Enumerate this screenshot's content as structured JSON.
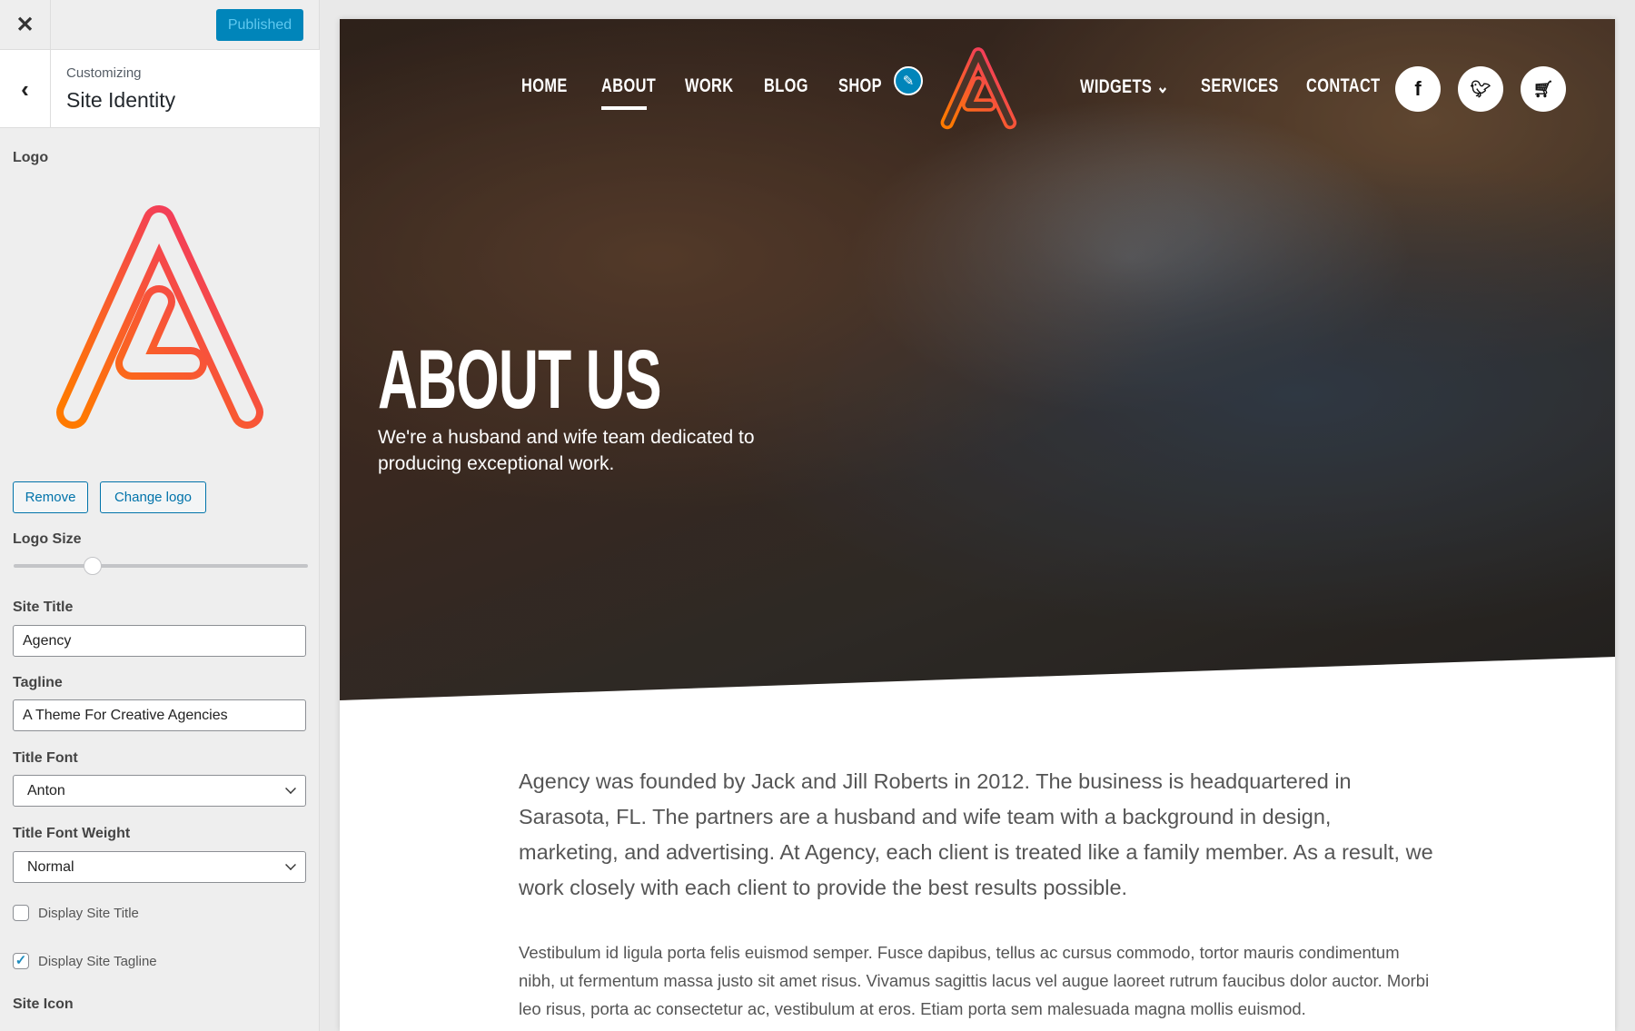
{
  "sidebar": {
    "publish_label": "Published",
    "header": {
      "customizing": "Customizing",
      "title": "Site Identity"
    },
    "logo_label": "Logo",
    "remove_label": "Remove",
    "change_logo_label": "Change logo",
    "logo_size_label": "Logo Size",
    "logo_size_value_fraction": 0.27,
    "site_title_label": "Site Title",
    "site_title_value": "Agency",
    "tagline_label": "Tagline",
    "tagline_value": "A Theme For Creative Agencies",
    "title_font_label": "Title Font",
    "title_font_value": "Anton",
    "title_font_weight_label": "Title Font Weight",
    "title_font_weight_value": "Normal",
    "display_site_title": {
      "label": "Display Site Title",
      "checked": false
    },
    "display_site_tagline": {
      "label": "Display Site Tagline",
      "checked": true
    },
    "site_icon_label": "Site Icon"
  },
  "preview": {
    "nav": [
      "HOME",
      "ABOUT",
      "WORK",
      "BLOG",
      "SHOP",
      "WIDGETS",
      "SERVICES",
      "CONTACT"
    ],
    "active_nav": "ABOUT",
    "social": [
      "facebook-icon",
      "twitter-icon",
      "cart-icon"
    ],
    "hero_title": "ABOUT US",
    "hero_tagline": "We're a husband and wife team dedicated to producing exceptional work.",
    "paragraph1": "Agency was founded by Jack and Jill Roberts in 2012. The business is headquartered in Sarasota, FL. The partners are a husband and wife team with a background in design, marketing, and advertising. At Agency, each client is treated like a family member. As a result, we work closely with each client to provide the best results possible.",
    "paragraph2": "Vestibulum id ligula porta felis euismod semper. Fusce dapibus, tellus ac cursus commodo, tortor mauris condimentum nibh, ut fermentum massa justo sit amet risus. Vivamus sagittis lacus vel augue laoreet rutrum faucibus dolor auctor. Morbi leo risus, porta ac consectetur ac, vestibulum at eros. Etiam porta sem malesuada magna mollis euismod."
  },
  "colors": {
    "accent": "#0085ba",
    "logo_gradient_start": "#ff7a00",
    "logo_gradient_end": "#f0306e"
  }
}
